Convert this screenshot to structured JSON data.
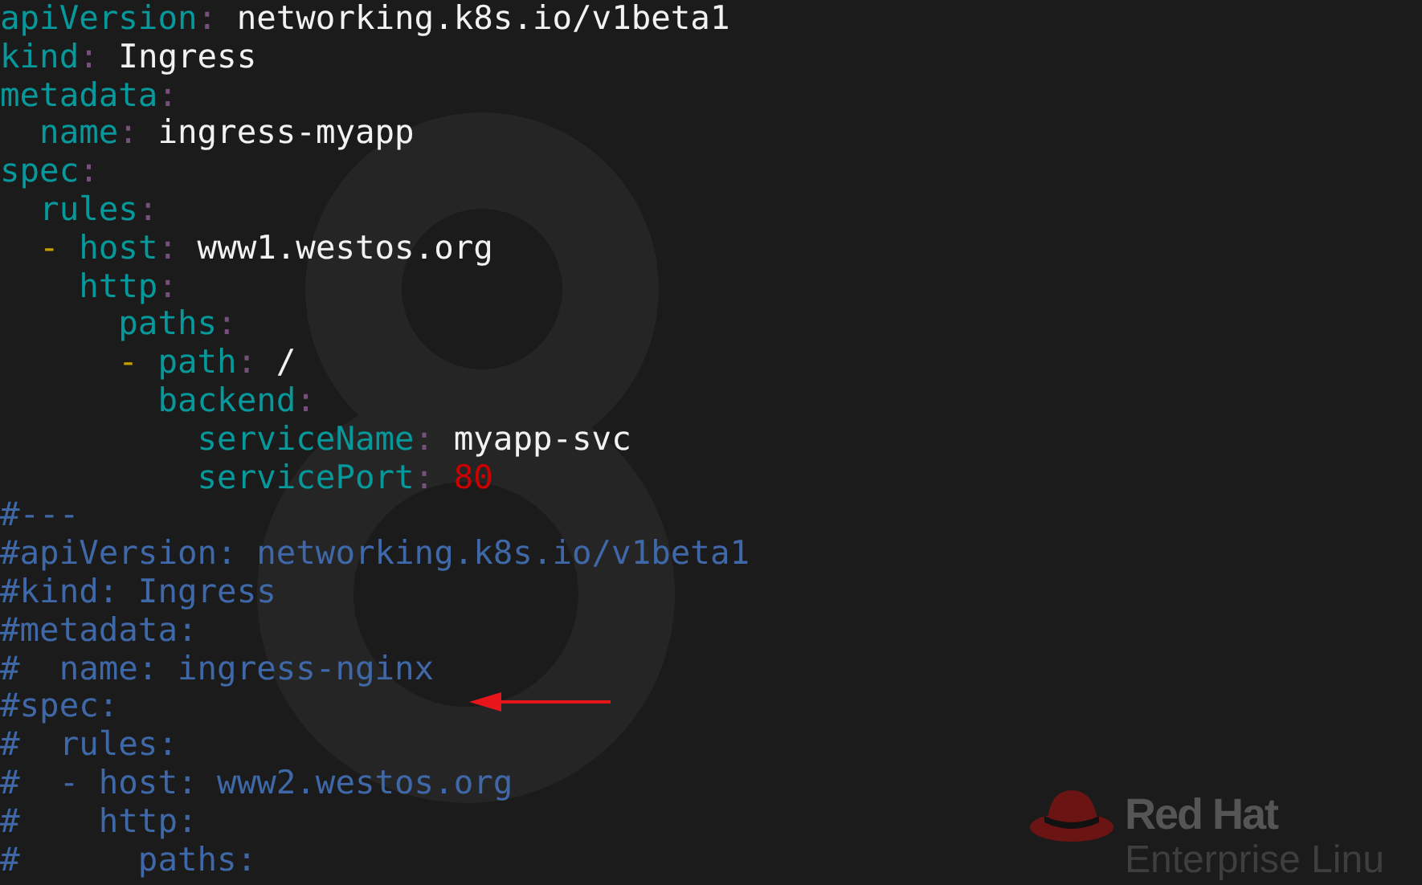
{
  "editor": {
    "lines": [
      [
        {
          "kind": "key",
          "text": "apiVersion"
        },
        {
          "kind": "colon",
          "text": ":"
        },
        {
          "kind": "value",
          "text": " networking.k8s.io/v1beta1"
        }
      ],
      [
        {
          "kind": "key",
          "text": "kind"
        },
        {
          "kind": "colon",
          "text": ":"
        },
        {
          "kind": "value",
          "text": " Ingress"
        }
      ],
      [
        {
          "kind": "key",
          "text": "metadata"
        },
        {
          "kind": "colon",
          "text": ":"
        }
      ],
      [
        {
          "kind": "key",
          "text": "  name"
        },
        {
          "kind": "colon",
          "text": ":"
        },
        {
          "kind": "value",
          "text": " ingress-myapp"
        }
      ],
      [
        {
          "kind": "key",
          "text": "spec"
        },
        {
          "kind": "colon",
          "text": ":"
        }
      ],
      [
        {
          "kind": "key",
          "text": "  rules"
        },
        {
          "kind": "colon",
          "text": ":"
        }
      ],
      [
        {
          "kind": "dash",
          "text": "  -"
        },
        {
          "kind": "key",
          "text": " host"
        },
        {
          "kind": "colon",
          "text": ":"
        },
        {
          "kind": "value",
          "text": " www1.westos.org"
        }
      ],
      [
        {
          "kind": "key",
          "text": "    http"
        },
        {
          "kind": "colon",
          "text": ":"
        }
      ],
      [
        {
          "kind": "key",
          "text": "      paths"
        },
        {
          "kind": "colon",
          "text": ":"
        }
      ],
      [
        {
          "kind": "dash",
          "text": "      -"
        },
        {
          "kind": "key",
          "text": " path"
        },
        {
          "kind": "colon",
          "text": ":"
        },
        {
          "kind": "value",
          "text": " /"
        }
      ],
      [
        {
          "kind": "key",
          "text": "        backend"
        },
        {
          "kind": "colon",
          "text": ":"
        }
      ],
      [
        {
          "kind": "key",
          "text": "          serviceName"
        },
        {
          "kind": "colon",
          "text": ":"
        },
        {
          "kind": "value",
          "text": " myapp-svc"
        }
      ],
      [
        {
          "kind": "key",
          "text": "          servicePort"
        },
        {
          "kind": "colon",
          "text": ":"
        },
        {
          "kind": "number",
          "text": " 80"
        }
      ],
      [
        {
          "kind": "comment",
          "text": "#---"
        }
      ],
      [
        {
          "kind": "comment",
          "text": "#apiVersion: networking.k8s.io/v1beta1"
        }
      ],
      [
        {
          "kind": "comment",
          "text": "#kind: Ingress"
        }
      ],
      [
        {
          "kind": "comment",
          "text": "#metadata:"
        }
      ],
      [
        {
          "kind": "comment",
          "text": "#  name: ingress-nginx"
        }
      ],
      [
        {
          "kind": "comment",
          "text": "#spec:"
        }
      ],
      [
        {
          "kind": "comment",
          "text": "#  rules:"
        }
      ],
      [
        {
          "kind": "comment",
          "text": "#  - host: www2.westos.org"
        }
      ],
      [
        {
          "kind": "comment",
          "text": "#    http:"
        }
      ],
      [
        {
          "kind": "comment",
          "text": "#      paths:"
        }
      ]
    ]
  },
  "wallpaper": {
    "brand": "Red Hat",
    "product": "Enterprise Linu"
  }
}
